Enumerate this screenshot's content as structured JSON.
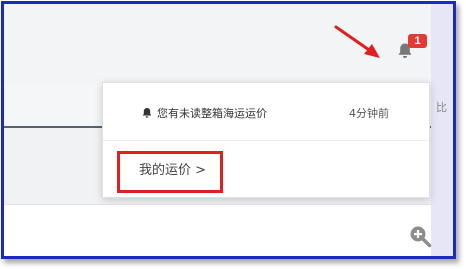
{
  "header": {
    "notification_count": "1",
    "edge_char": "比"
  },
  "notification_popover": {
    "item": {
      "text": "您有未读整箱海运运价",
      "time": "4分钟前"
    },
    "my_link": "我的运价 >"
  },
  "colors": {
    "badge": "#e53935",
    "annotation_red": "#e02020",
    "frame_blue": "#1d2bbd"
  },
  "icons": {
    "bell": "bell-icon",
    "zoom": "zoom-in-icon",
    "arrow": "red-arrow-annotation"
  }
}
